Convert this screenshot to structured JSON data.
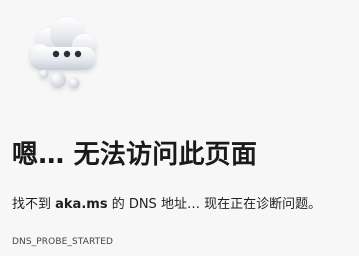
{
  "page": {
    "title": "嗯… 无法访问此页面",
    "message": {
      "before": "找不到 ",
      "host": "aka.ms",
      "after": " 的 DNS 地址… 现在正在诊断问题。"
    },
    "error_code": "DNS_PROBE_STARTED"
  },
  "icon": {
    "name": "cloud-ellipsis-icon",
    "colors": {
      "cloud_light": "#f1f3f7",
      "cloud_dark": "#c8ccd5",
      "dots": "#2b2f37"
    }
  }
}
